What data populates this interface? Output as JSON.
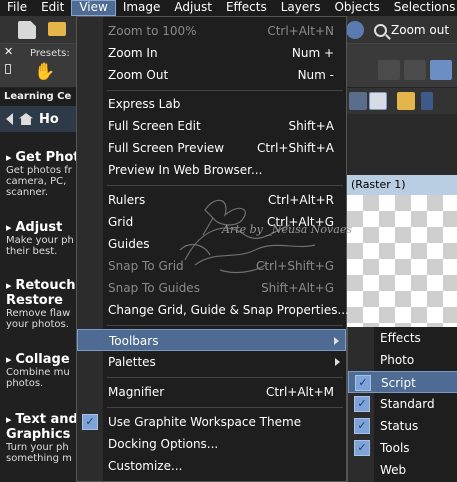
{
  "menubar": [
    {
      "id": "file",
      "label": "File"
    },
    {
      "id": "edit",
      "label": "Edit"
    },
    {
      "id": "view",
      "label": "View"
    },
    {
      "id": "image",
      "label": "Image"
    },
    {
      "id": "adjust",
      "label": "Adjust"
    },
    {
      "id": "effects",
      "label": "Effects"
    },
    {
      "id": "layers",
      "label": "Layers"
    },
    {
      "id": "objects",
      "label": "Objects"
    },
    {
      "id": "selections",
      "label": "Selections"
    }
  ],
  "toolbar": {
    "zoom_out_label": "Zoom out"
  },
  "presets": {
    "label": "Presets:"
  },
  "learning_center": {
    "header": "Learning Ce",
    "nav_title": "Ho",
    "items": [
      {
        "title": "Get Photo",
        "desc": "Get photos fr\ncamera, PC,\nscanner."
      },
      {
        "title": "Adjust",
        "desc": "Make your ph\ntheir best."
      },
      {
        "title": "Retouch\nRestore",
        "desc": "Remove flaw\nyour photos."
      },
      {
        "title": "Collage",
        "desc": "Combine mu\nphotos."
      },
      {
        "title": "Text and\nGraphics",
        "desc": "Turn your ph\nsomething m"
      }
    ]
  },
  "canvas": {
    "title": "(Raster 1)"
  },
  "view_menu": {
    "zoom_100": {
      "label": "Zoom to 100%",
      "shortcut": "Ctrl+Alt+N"
    },
    "zoom_in": {
      "label": "Zoom In",
      "shortcut": "Num +"
    },
    "zoom_out": {
      "label": "Zoom Out",
      "shortcut": "Num -"
    },
    "express_lab": {
      "label": "Express Lab"
    },
    "full_screen_edit": {
      "label": "Full Screen Edit",
      "shortcut": "Shift+A"
    },
    "full_screen_preview": {
      "label": "Full Screen Preview",
      "shortcut": "Ctrl+Shift+A"
    },
    "preview_web": {
      "label": "Preview In Web Browser..."
    },
    "rulers": {
      "label": "Rulers",
      "shortcut": "Ctrl+Alt+R"
    },
    "grid": {
      "label": "Grid",
      "shortcut": "Ctrl+Alt+G"
    },
    "guides": {
      "label": "Guides"
    },
    "snap_grid": {
      "label": "Snap To Grid",
      "shortcut": "Ctrl+Shift+G"
    },
    "snap_guides": {
      "label": "Snap To Guides",
      "shortcut": "Shift+Alt+G"
    },
    "change_grid": {
      "label": "Change Grid, Guide & Snap Properties..."
    },
    "toolbars": {
      "label": "Toolbars"
    },
    "palettes": {
      "label": "Palettes"
    },
    "magnifier": {
      "label": "Magnifier",
      "shortcut": "Ctrl+Alt+M"
    },
    "graphite": {
      "label": "Use Graphite Workspace Theme"
    },
    "docking": {
      "label": "Docking Options..."
    },
    "customize": {
      "label": "Customize..."
    }
  },
  "toolbars_submenu": [
    {
      "label": "Effects",
      "checked": false,
      "highlighted": false
    },
    {
      "label": "Photo",
      "checked": false,
      "highlighted": false
    },
    {
      "label": "Script",
      "checked": true,
      "highlighted": true
    },
    {
      "label": "Standard",
      "checked": true,
      "highlighted": false
    },
    {
      "label": "Status",
      "checked": true,
      "highlighted": false
    },
    {
      "label": "Tools",
      "checked": true,
      "highlighted": false
    },
    {
      "label": "Web",
      "checked": false,
      "highlighted": false
    }
  ],
  "watermark": {
    "text": "Arte by _Neusa Novaes"
  },
  "colors": {
    "accent": "#4e6b93",
    "menu_bg": "#1e1e1e",
    "check": "#7ea3d8"
  }
}
